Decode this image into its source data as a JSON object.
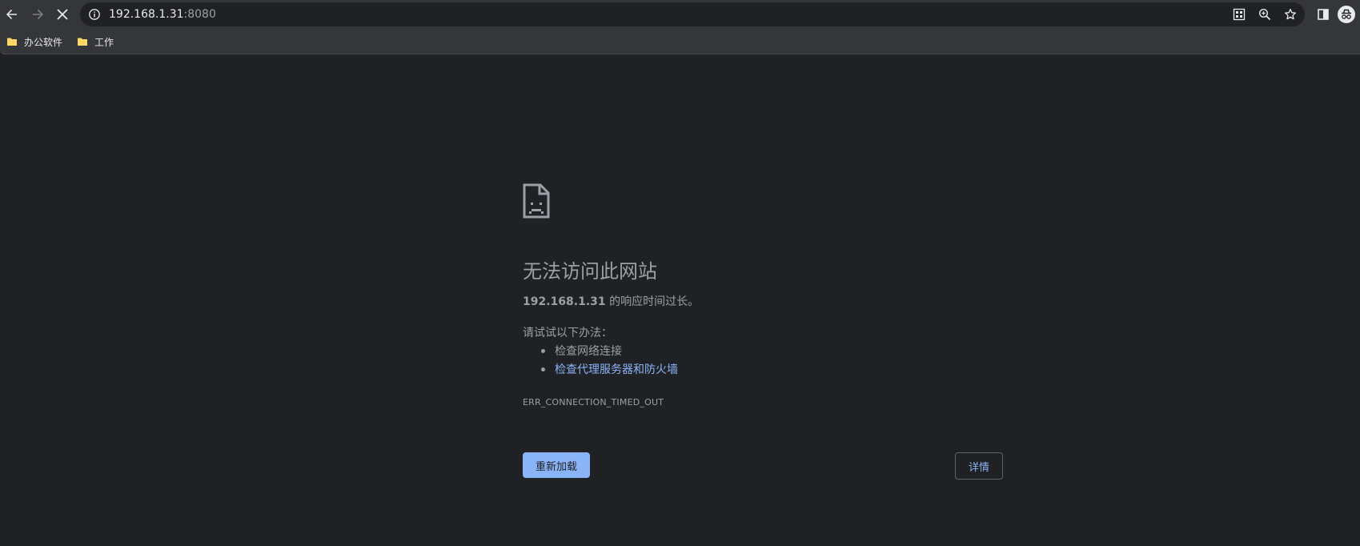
{
  "toolbar": {
    "url_host": "192.168.1.31",
    "url_port": ":8080",
    "icons": {
      "back": "back-arrow-icon",
      "forward": "forward-arrow-icon",
      "stop": "stop-loading-icon",
      "site_info": "info-icon",
      "qr": "qr-code-icon",
      "zoom": "zoom-icon",
      "bookmark": "star-icon",
      "side_panel": "side-panel-icon",
      "profile": "incognito-icon"
    }
  },
  "bookmarks": [
    {
      "label": "办公软件",
      "icon": "folder-icon"
    },
    {
      "label": "工作",
      "icon": "folder-icon"
    }
  ],
  "error": {
    "title": "无法访问此网站",
    "host": "192.168.1.31",
    "message_suffix": " 的响应时间过长。",
    "try_label": "请试试以下办法：",
    "suggestions": [
      "检查网络连接",
      "检查代理服务器和防火墙"
    ],
    "code": "ERR_CONNECTION_TIMED_OUT",
    "reload_label": "重新加载",
    "details_label": "详情"
  },
  "colors": {
    "page_bg": "#202124",
    "toolbar_bg": "#35363a",
    "text": "#9aa0a6",
    "link": "#8ab4f8"
  }
}
